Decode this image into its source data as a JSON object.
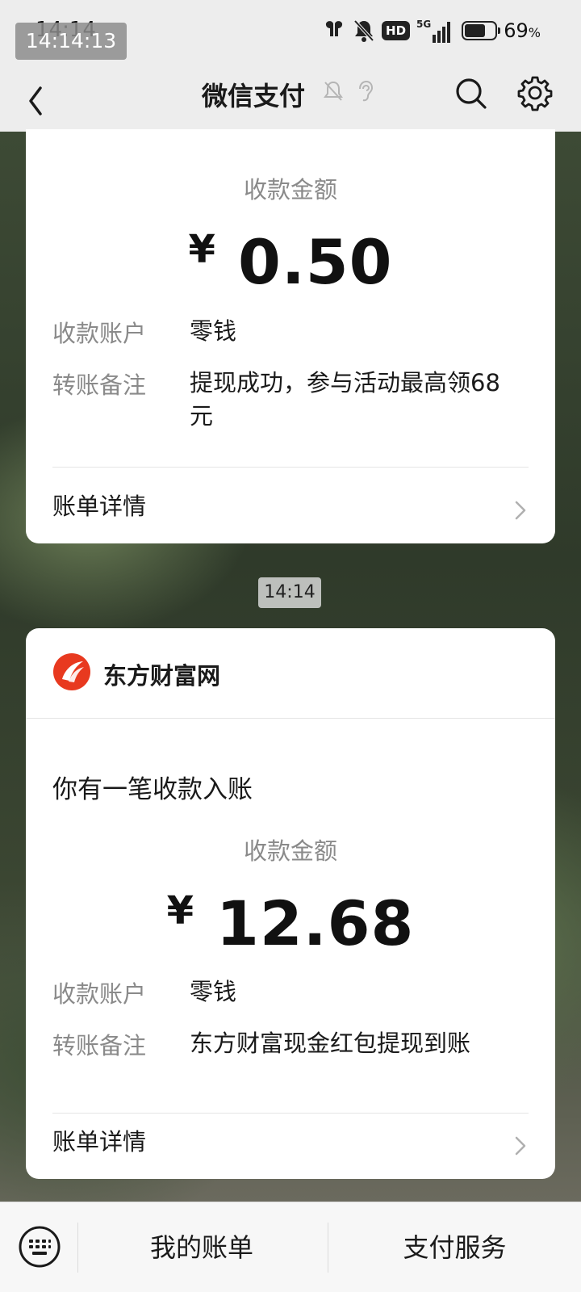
{
  "status_bar": {
    "time": "14:14",
    "screenshot_time": "14:14:13",
    "battery_percent": "69",
    "battery_unit": "%",
    "battery_level": 0.69,
    "network": "5G",
    "hd_badge": "HD"
  },
  "header": {
    "title": "微信支付",
    "back_icon": "back-arrow-icon",
    "muted_icons": [
      "bell-muted-icon",
      "ear-icon"
    ],
    "search_icon": "search-icon",
    "settings_icon": "gear-icon"
  },
  "cards": [
    {
      "amount_label": "收款金额",
      "currency": "¥",
      "amount": "0.50",
      "fields": [
        {
          "key": "收款账户",
          "value": "零钱"
        },
        {
          "key": "转账备注",
          "value": "提现成功，参与活动最高领68元"
        }
      ],
      "detail_link": "账单详情"
    },
    {
      "brand": "东方财富网",
      "headline": "你有一笔收款入账",
      "amount_label": "收款金额",
      "currency": "¥",
      "amount": "12.68",
      "fields": [
        {
          "key": "收款账户",
          "value": "零钱"
        },
        {
          "key": "转账备注",
          "value": "东方财富现金红包提现到账"
        }
      ],
      "detail_link": "账单详情"
    }
  ],
  "timestamp": "14:14",
  "bottom_bar": {
    "items": [
      "我的账单",
      "支付服务"
    ],
    "keyboard_icon": "keyboard-icon"
  },
  "colors": {
    "header_bg": "#ededed",
    "brand_red": "#e8391f",
    "muted_text": "#8a8a8a"
  }
}
